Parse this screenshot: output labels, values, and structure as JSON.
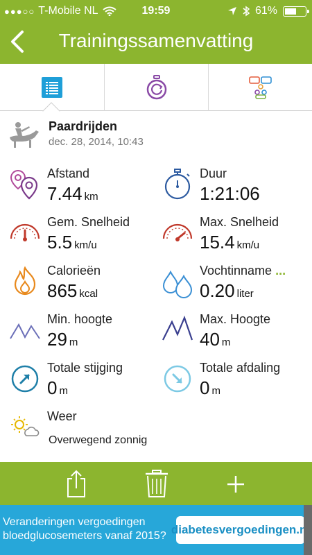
{
  "status_bar": {
    "carrier": "T-Mobile NL",
    "time": "19:59",
    "battery": "61%",
    "battery_level": 0.61,
    "signal_dots": "●●●○○"
  },
  "header": {
    "title": "Trainingssamenvatting"
  },
  "tabs": [
    {
      "icon": "list-icon",
      "active": true
    },
    {
      "icon": "stopwatch-replay-icon",
      "active": false
    },
    {
      "icon": "people-chat-icon",
      "active": false
    }
  ],
  "activity": {
    "name": "Paardrijden",
    "date": "dec. 28, 2014, 10:43"
  },
  "stats": {
    "distance": {
      "label": "Afstand",
      "value": "7.44",
      "unit": "km"
    },
    "duration": {
      "label": "Duur",
      "value": "1:21:06",
      "unit": ""
    },
    "avg_speed": {
      "label": "Gem. Snelheid",
      "value": "5.5",
      "unit": "km/u"
    },
    "max_speed": {
      "label": "Max. Snelheid",
      "value": "15.4",
      "unit": "km/u"
    },
    "calories": {
      "label": "Calorieën",
      "value": "865",
      "unit": "kcal"
    },
    "hydration": {
      "label": "Vochtinname",
      "more": "...",
      "value": "0.20",
      "unit": "liter"
    },
    "min_altitude": {
      "label": "Min. hoogte",
      "value": "29",
      "unit": "m"
    },
    "max_altitude": {
      "label": "Max. Hoogte",
      "value": "40",
      "unit": "m"
    },
    "ascent": {
      "label": "Totale stijging",
      "value": "0",
      "unit": "m"
    },
    "descent": {
      "label": "Totale afdaling",
      "value": "0",
      "unit": "m"
    },
    "weather": {
      "label": "Weer",
      "value": "Overwegend zonnig"
    }
  },
  "colors": {
    "brand_green": "#8cb52f",
    "ad_blue": "#27a7d9"
  },
  "ad": {
    "line1": "Veranderingen vergoedingen",
    "line2": "bloedglucosemeters vanaf 2015?",
    "logo_text": "diabetesvergoedingen.nl"
  }
}
